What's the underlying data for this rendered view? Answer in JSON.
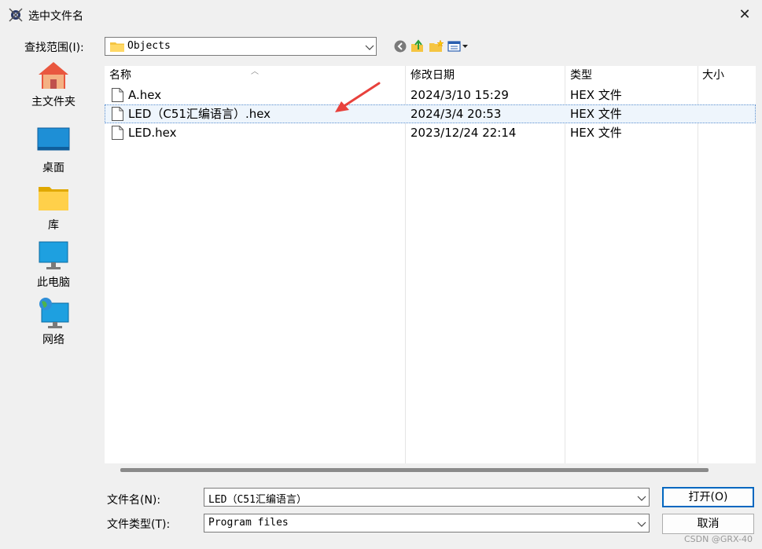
{
  "window": {
    "title": "选中文件名",
    "close": "✕"
  },
  "lookin": {
    "label": "查找范围(I):",
    "value": "Objects"
  },
  "places": [
    {
      "label": "主文件夹"
    },
    {
      "label": "桌面"
    },
    {
      "label": "库"
    },
    {
      "label": "此电脑"
    },
    {
      "label": "网络"
    }
  ],
  "list": {
    "columns": [
      "名称",
      "修改日期",
      "类型",
      "大小"
    ],
    "rows": [
      {
        "name": "A.hex",
        "date": "2024/3/10 15:29",
        "type": "HEX 文件",
        "size": ""
      },
      {
        "name": "LED（C51汇编语言）.hex",
        "date": "2024/3/4 20:53",
        "type": "HEX 文件",
        "size": ""
      },
      {
        "name": "LED.hex",
        "date": "2023/12/24 22:14",
        "type": "HEX 文件",
        "size": ""
      }
    ]
  },
  "filename": {
    "label": "文件名(N):",
    "value": "LED（C51汇编语言）"
  },
  "filetype": {
    "label": "文件类型(T):",
    "value": "Program files"
  },
  "buttons": {
    "open": "打开(O)",
    "cancel": "取消"
  },
  "watermark": "CSDN @GRX-40",
  "colors": {
    "selection": "#eef5fc",
    "accent": "#0067c0",
    "annotation_arrow": "#e8413c"
  }
}
